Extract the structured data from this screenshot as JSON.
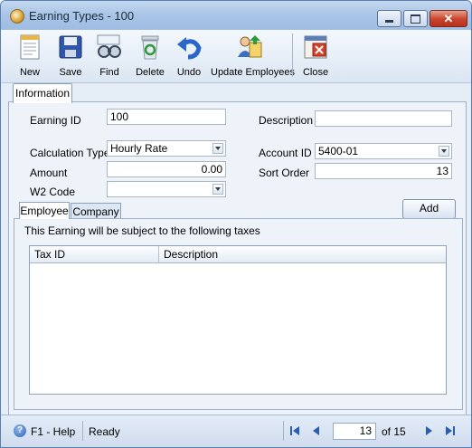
{
  "window": {
    "title": "Earning Types - 100",
    "close_glyph": "✕"
  },
  "toolbar": {
    "new": "New",
    "save": "Save",
    "find": "Find",
    "delete": "Delete",
    "undo": "Undo",
    "update_employees": "Update Employees",
    "close": "Close"
  },
  "tabs": {
    "information": "Information"
  },
  "form": {
    "earning_id_label": "Earning ID",
    "earning_id_value": "100",
    "description_label": "Description",
    "description_value": "",
    "calculation_type_label": "Calculation Type",
    "calculation_type_value": "Hourly Rate",
    "account_id_label": "Account ID",
    "account_id_value": "5400-01",
    "amount_label": "Amount",
    "amount_value": "0.00",
    "sort_order_label": "Sort Order",
    "sort_order_value": "13",
    "w2_code_label": "W2 Code",
    "w2_code_value": ""
  },
  "subtabs": {
    "employee": "Employee",
    "company": "Company"
  },
  "add_button": "Add",
  "taxes_note": "This Earning will be subject to the following taxes",
  "grid": {
    "columns": [
      "Tax ID",
      "Description"
    ],
    "rows": []
  },
  "status": {
    "help": "F1 - Help",
    "state": "Ready",
    "help_glyph": "?",
    "current_page": "13",
    "of_label": "of 15"
  },
  "icons": [
    "app-icon",
    "new-icon",
    "save-icon",
    "find-icon",
    "delete-icon",
    "undo-icon",
    "update-employees-icon",
    "close-icon",
    "help-icon",
    "first-icon",
    "prev-icon",
    "next-icon",
    "last-icon"
  ]
}
